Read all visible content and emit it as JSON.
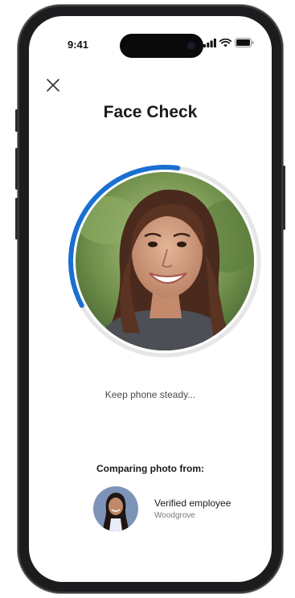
{
  "status_bar": {
    "time": "9:41"
  },
  "header": {
    "title": "Face Check"
  },
  "scan": {
    "instruction": "Keep phone steady...",
    "progress": 0.35
  },
  "comparison": {
    "label": "Comparing photo from:",
    "source_name": "Verified employee",
    "source_org": "Woodgrove"
  },
  "colors": {
    "accent": "#1a6fd1",
    "ring": "#e6e6e6"
  },
  "icons": {
    "close": "close-icon",
    "signal": "signal-icon",
    "wifi": "wifi-icon",
    "battery": "battery-icon"
  }
}
